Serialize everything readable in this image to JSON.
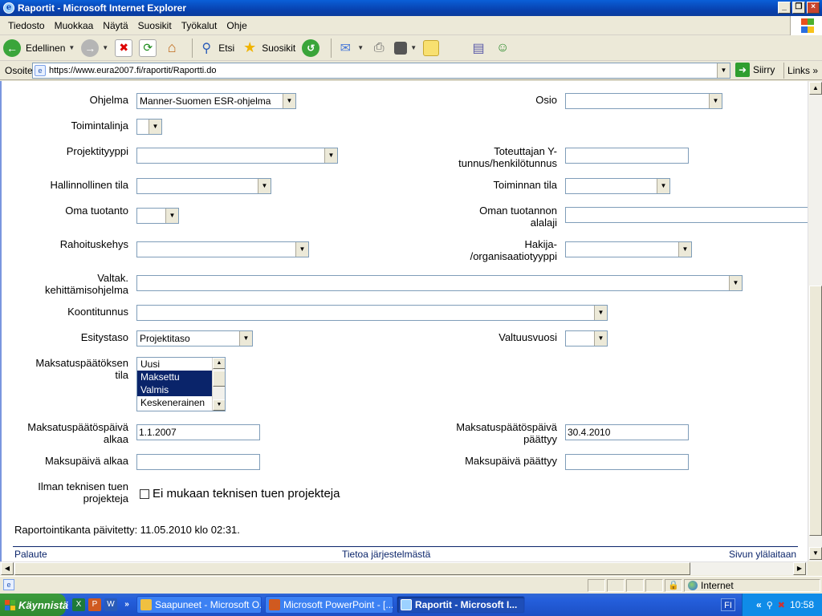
{
  "window": {
    "title": "Raportit - Microsoft Internet Explorer"
  },
  "menu": [
    "Tiedosto",
    "Muokkaa",
    "Näytä",
    "Suosikit",
    "Työkalut",
    "Ohje"
  ],
  "toolbar": {
    "back_label": "Edellinen",
    "search_label": "Etsi",
    "favorites_label": "Suosikit"
  },
  "address": {
    "label": "Osoite",
    "url": "https://www.eura2007.fi/raportit/Raportti.do",
    "go_label": "Siirry",
    "links_label": "Links"
  },
  "form": {
    "ohjelma": {
      "label": "Ohjelma",
      "value": "Manner-Suomen ESR-ohjelma"
    },
    "osio": {
      "label": "Osio",
      "value": ""
    },
    "toimintalinja": {
      "label": "Toimintalinja",
      "value": ""
    },
    "projektityyppi": {
      "label": "Projektityyppi",
      "value": ""
    },
    "toteuttaja": {
      "label1": "Toteuttajan Y-",
      "label2": "tunnus/henkilötunnus",
      "value": ""
    },
    "hallinnollinen": {
      "label": "Hallinnollinen tila",
      "value": ""
    },
    "toiminnan": {
      "label": "Toiminnan tila",
      "value": ""
    },
    "oma": {
      "label": "Oma tuotanto",
      "value": ""
    },
    "oman_alalaji": {
      "label1": "Oman tuotannon",
      "label2": "alalaji",
      "value": ""
    },
    "rahoituskehys": {
      "label": "Rahoituskehys",
      "value": ""
    },
    "hakija": {
      "label1": "Hakija-",
      "label2": "/organisaatiotyyppi",
      "value": ""
    },
    "valtak": {
      "label1": "Valtak.",
      "label2": "kehittämisohjelma",
      "value": ""
    },
    "koontitunnus": {
      "label": "Koontitunnus",
      "value": ""
    },
    "esitystaso": {
      "label": "Esitystaso",
      "value": "Projektitaso"
    },
    "valtuusvuosi": {
      "label": "Valtuusvuosi",
      "value": ""
    },
    "maksatus_tila": {
      "label1": "Maksatuspäätöksen",
      "label2": "tila",
      "options": [
        "Uusi",
        "Maksettu",
        "Valmis",
        "Keskenerainen"
      ]
    },
    "mp_alkaa": {
      "label1": "Maksatuspäätöspäivä",
      "label2": "alkaa",
      "value": "1.1.2007"
    },
    "mp_paattyy": {
      "label1": "Maksatuspäätöspäivä",
      "label2": "päättyy",
      "value": "30.4.2010"
    },
    "maksupaiva_alkaa": {
      "label": "Maksupäivä alkaa",
      "value": ""
    },
    "maksupaiva_paattyy": {
      "label": "Maksupäivä päättyy",
      "value": ""
    },
    "tekninen": {
      "label1": "Ilman teknisen tuen",
      "label2": "projekteja",
      "check_label": "Ei mukaan teknisen tuen projekteja"
    }
  },
  "updated": "Raportointikanta päivitetty: 11.05.2010 klo 02:31.",
  "footer": {
    "left": "Palaute",
    "center": "Tietoa järjestelmästä",
    "right": "Sivun ylälaitaan"
  },
  "status": {
    "zone": "Internet"
  },
  "taskbar": {
    "start": "Käynnistä",
    "tasks": [
      "Saapuneet - Microsoft O...",
      "Microsoft PowerPoint - [...",
      "Raportit - Microsoft I..."
    ],
    "lang": "FI",
    "clock": "10:58"
  }
}
